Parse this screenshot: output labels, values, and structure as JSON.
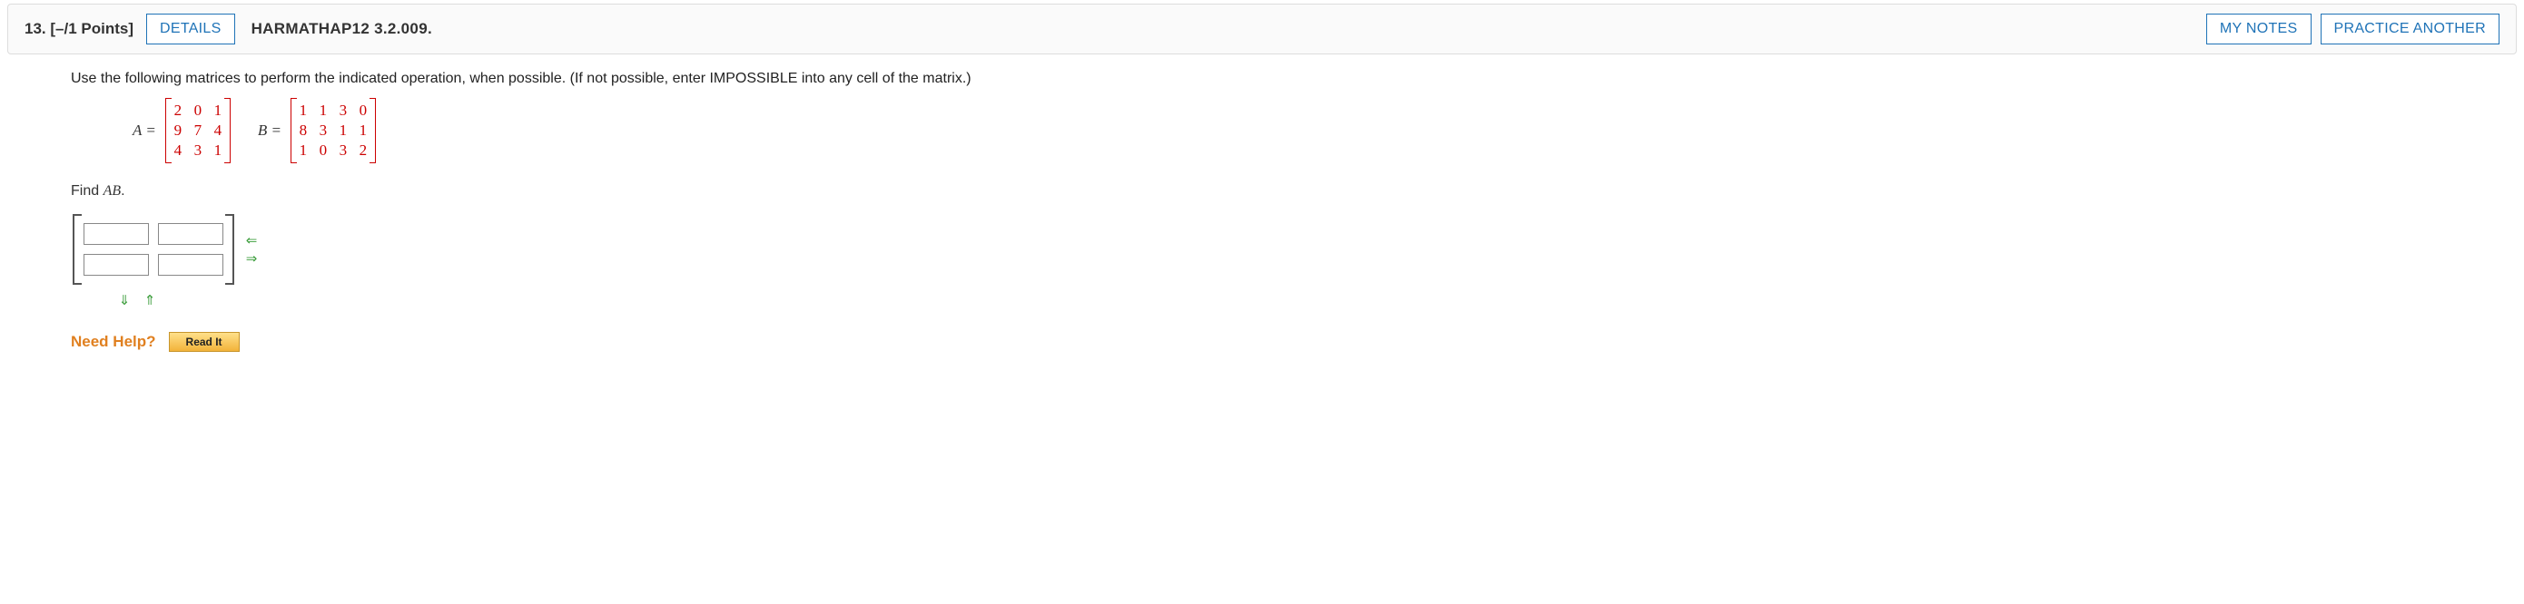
{
  "header": {
    "qnum": "13.",
    "points": "[–/1 Points]",
    "details_label": "DETAILS",
    "assignment_id": "HARMATHAP12 3.2.009.",
    "my_notes_label": "MY NOTES",
    "practice_label": "PRACTICE ANOTHER"
  },
  "prompt": {
    "instructions": "Use the following matrices to perform the indicated operation, when possible. (If not possible, enter IMPOSSIBLE into any cell of the matrix.)",
    "matrix_a_label": "A =",
    "matrix_b_label": "B =",
    "matrix_a": [
      [
        "2",
        "0",
        "1"
      ],
      [
        "9",
        "7",
        "4"
      ],
      [
        "4",
        "3",
        "1"
      ]
    ],
    "matrix_b": [
      [
        "1",
        "1",
        "3",
        "0"
      ],
      [
        "8",
        "3",
        "1",
        "1"
      ],
      [
        "1",
        "0",
        "3",
        "2"
      ]
    ],
    "find_prefix": "Find ",
    "find_expr": "AB",
    "find_suffix": "."
  },
  "answer": {
    "cells": [
      [
        "",
        ""
      ],
      [
        "",
        ""
      ]
    ]
  },
  "help": {
    "label": "Need Help?",
    "read_it": "Read It"
  }
}
